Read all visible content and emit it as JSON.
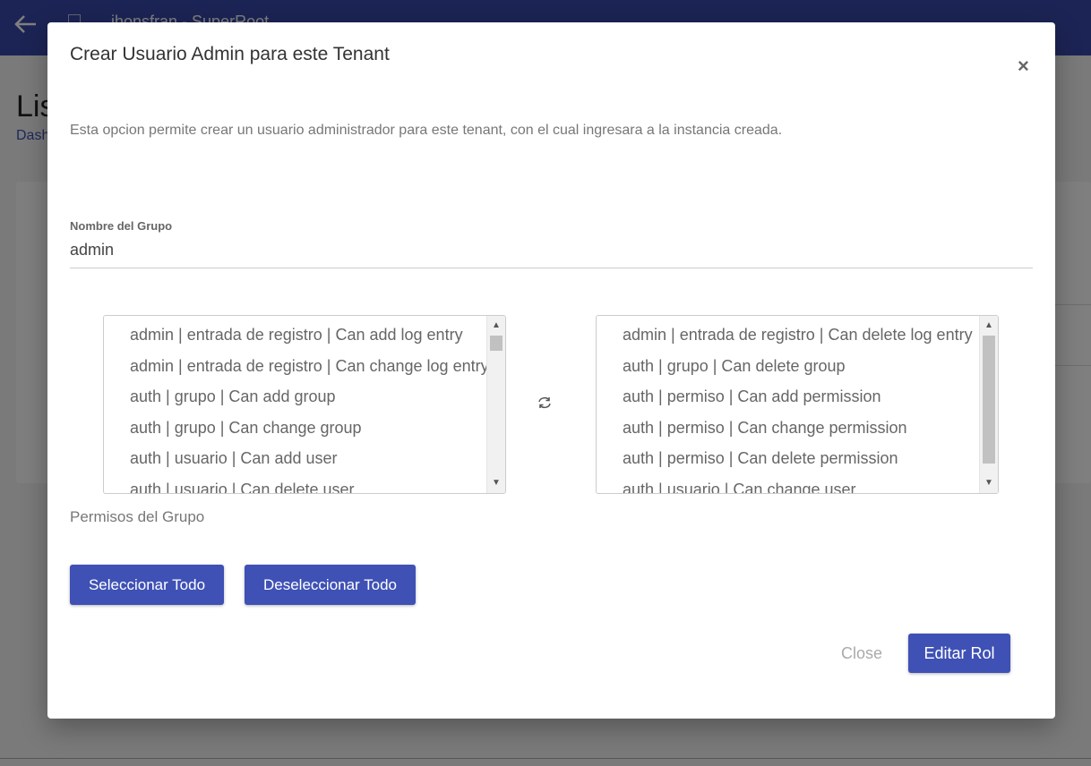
{
  "app": {
    "brand": "jhonsfran - SuperRoot",
    "page_title": "Lis",
    "breadcrumb": "Dash"
  },
  "modal": {
    "title": "Crear Usuario Admin para este Tenant",
    "close_glyph": "×",
    "description": "Esta opcion permite crear un usuario administrador para este tenant, con el cual ingresara a la instancia creada.",
    "group_name_label": "Nombre del Grupo",
    "group_name_value": "admin",
    "permissions_helper": "Permisos del Grupo",
    "available_permissions": [
      "admin | entrada de registro | Can add log entry",
      "admin | entrada de registro | Can change log entry",
      "auth | grupo | Can add group",
      "auth | grupo | Can change group",
      "auth | usuario | Can add user",
      "auth | usuario | Can delete user"
    ],
    "selected_permissions": [
      "admin | entrada de registro | Can delete log entry",
      "auth | grupo | Can delete group",
      "auth | permiso | Can add permission",
      "auth | permiso | Can change permission",
      "auth | permiso | Can delete permission",
      "auth | usuario | Can change user"
    ],
    "swap_icon": "swap-icon",
    "buttons": {
      "select_all": "Seleccionar Todo",
      "deselect_all": "Deseleccionar Todo",
      "close": "Close",
      "submit": "Editar Rol"
    }
  },
  "colors": {
    "primary": "#3f51b5",
    "topbar": "#3949ab"
  }
}
